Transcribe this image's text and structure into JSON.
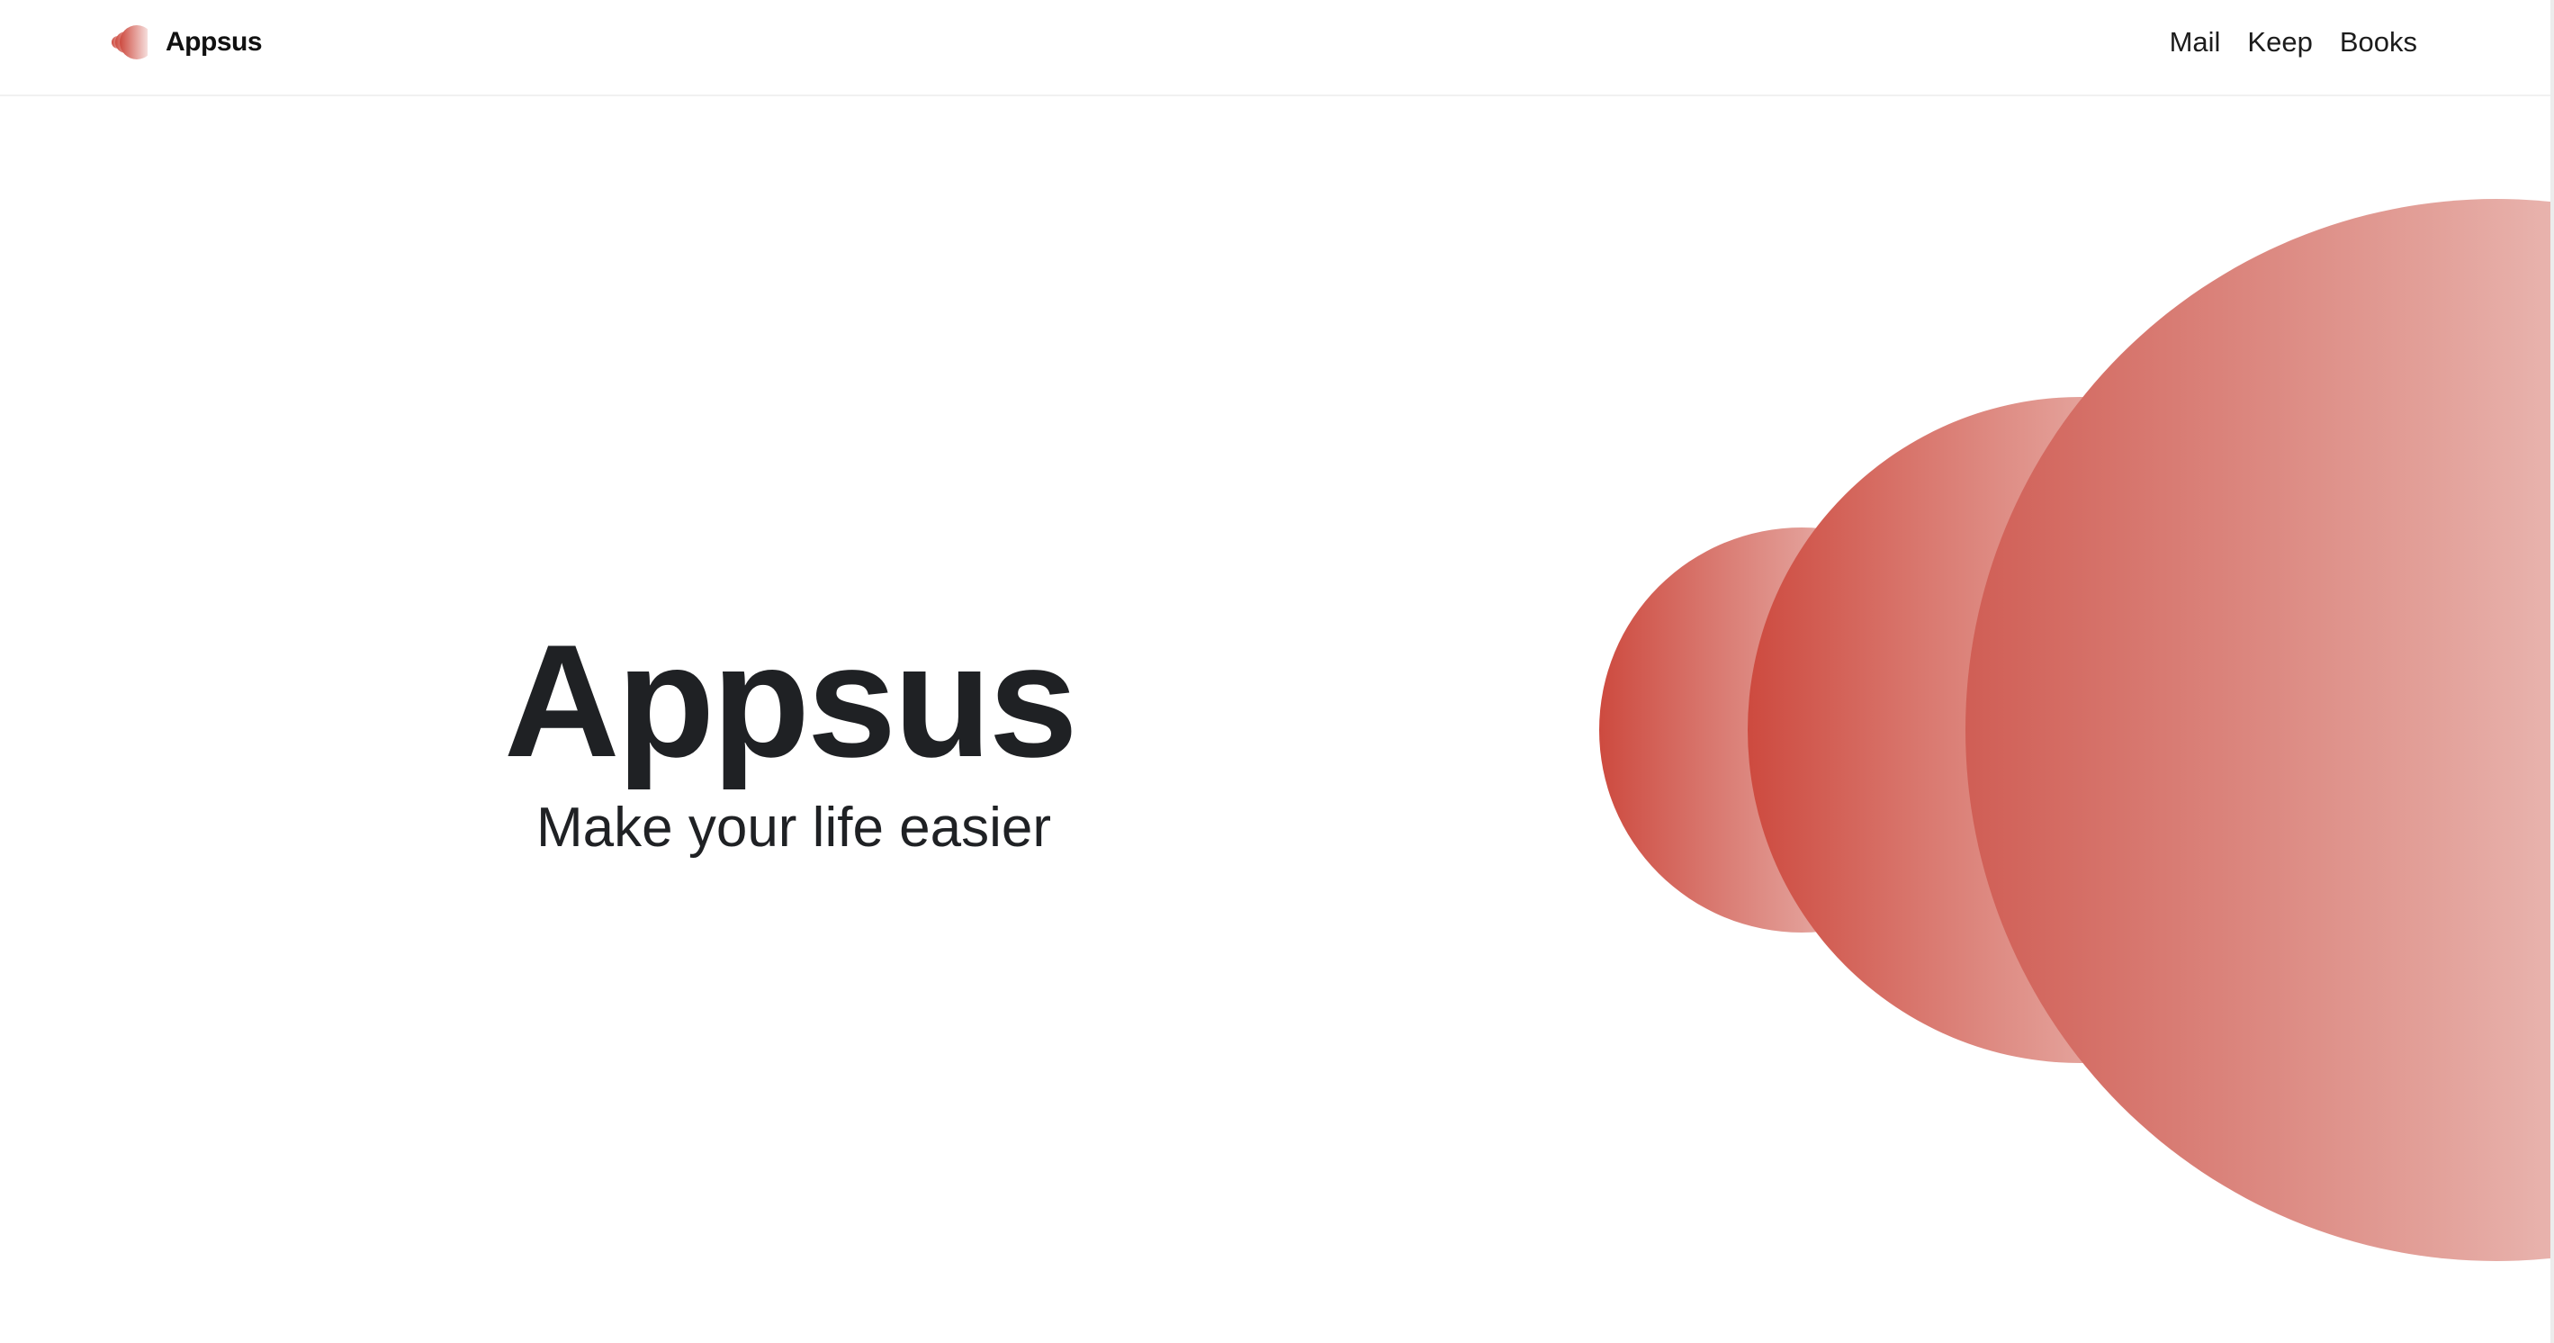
{
  "header": {
    "brand": {
      "name": "Appsus",
      "logo_icon": "sound-wave-icon"
    },
    "nav": [
      {
        "label": "Mail"
      },
      {
        "label": "Keep"
      },
      {
        "label": "Books"
      }
    ]
  },
  "hero": {
    "title": "Appsus",
    "subtitle": "Make your life easier"
  },
  "colors": {
    "accent": "#cd4a3f",
    "accent_light": "#f3d6d2",
    "text": "#1f2124",
    "background": "#ffffff"
  }
}
